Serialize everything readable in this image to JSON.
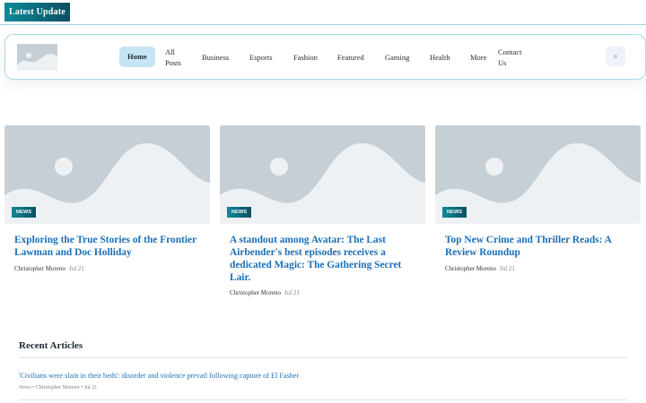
{
  "ticker": {
    "label": "Latest Update"
  },
  "nav": {
    "items": [
      {
        "label": "Home",
        "active": true
      },
      {
        "label": "All Posts"
      },
      {
        "label": "Business"
      },
      {
        "label": "Esports"
      },
      {
        "label": "Fashion"
      },
      {
        "label": "Featured"
      },
      {
        "label": "Gaming"
      },
      {
        "label": "Health"
      },
      {
        "label": "More"
      },
      {
        "label": "Contact Us"
      }
    ]
  },
  "cards": [
    {
      "badge": "NEWS",
      "title": "Exploring the True Stories of the Frontier Lawman and Doc Holliday",
      "author": "Christopher Moreno",
      "date": "Jul 21"
    },
    {
      "badge": "NEWS",
      "title": "A standout among Avatar: The Last Airbender's best episodes receives a dedicated Magic: The Gathering Secret Lair.",
      "author": "Christopher Moreno",
      "date": "Jul 21"
    },
    {
      "badge": "NEWS",
      "title": "Top New Crime and Thriller Reads: A Review Roundup",
      "author": "Christopher Moreno",
      "date": "Jul 21"
    }
  ],
  "recent": {
    "heading": "Recent Articles",
    "items": [
      {
        "title": "'Civilians were slain in their beds': disorder and violence prevail following capture of El Fasher",
        "meta": "News • Christopher Moreno • Jul 21"
      }
    ]
  },
  "colors": {
    "accent_start": "#0e8a98",
    "accent_end": "#0b4f62",
    "link": "#1c6fb8",
    "nav_active": "#c6e4f4",
    "placeholder": "#c6ced6"
  }
}
